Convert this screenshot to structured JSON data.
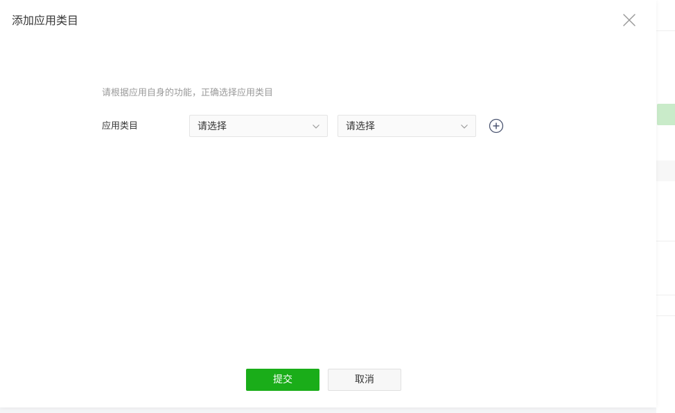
{
  "dialog": {
    "title": "添加应用类目",
    "hint": "请根据应用自身的功能，正确选择应用类目",
    "category_label": "应用类目",
    "select_primary": {
      "value": "请选择"
    },
    "select_secondary": {
      "value": "请选择"
    },
    "submit_label": "提交",
    "cancel_label": "取消"
  },
  "colors": {
    "primary": "#1aad19",
    "hint_text": "#9a9a9a",
    "text": "#353535"
  },
  "icons": {
    "close": "close-icon",
    "chevron": "chevron-down-icon",
    "add": "plus-circle-icon"
  }
}
